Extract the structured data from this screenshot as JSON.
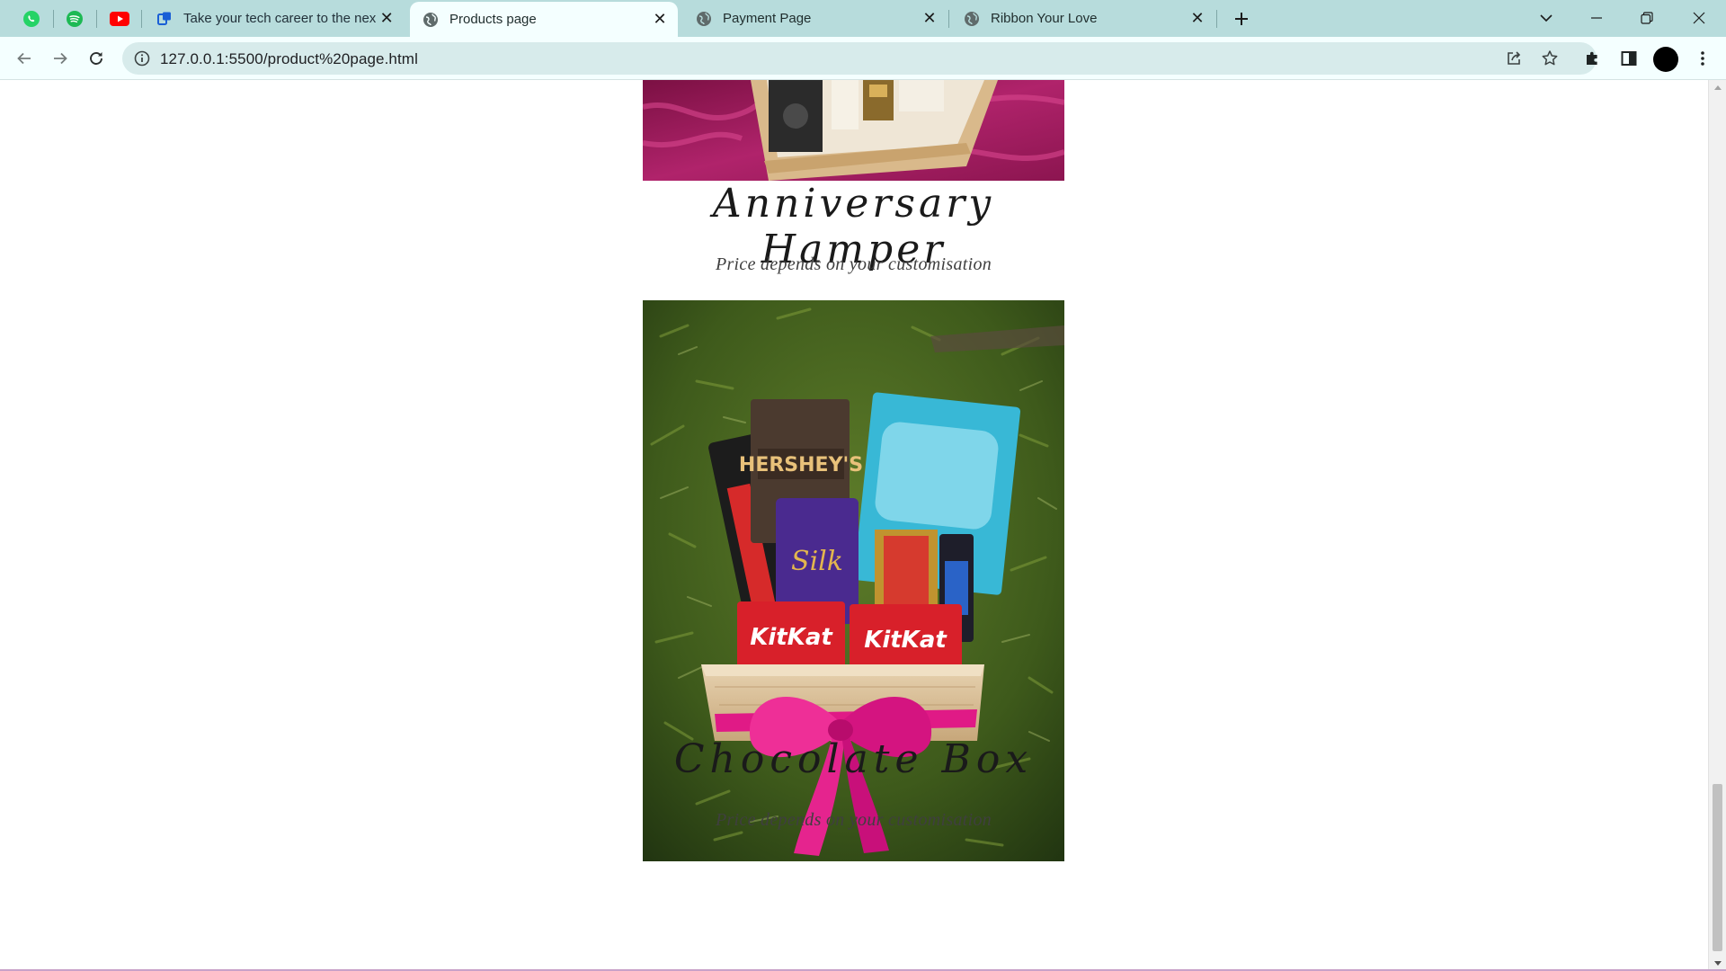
{
  "browser": {
    "pinned_tabs": [
      {
        "icon": "whatsapp-icon",
        "color": "#25d366"
      },
      {
        "icon": "spotify-icon",
        "color": "#1db954"
      },
      {
        "icon": "youtube-icon",
        "color": "#ff0000"
      }
    ],
    "tabs": [
      {
        "title": "Take your tech career to the next",
        "active": false
      },
      {
        "title": "Products page",
        "active": true
      },
      {
        "title": "Payment Page",
        "active": false
      },
      {
        "title": "Ribbon Your Love",
        "active": false
      }
    ],
    "url": "127.0.0.1:5500/product%20page.html",
    "accent_color": "#b7dcdc"
  },
  "products": [
    {
      "name": "Anniversary Hamper",
      "price": "Price depends on your customisation"
    },
    {
      "name": "Chocolate Box",
      "price": "Price depends on your customisation"
    }
  ]
}
